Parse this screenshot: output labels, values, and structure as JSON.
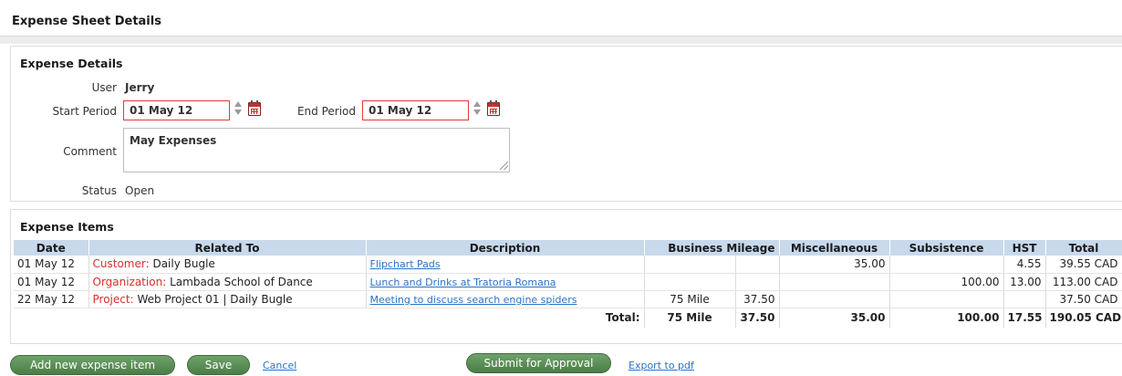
{
  "page": {
    "title": "Expense Sheet Details"
  },
  "details": {
    "section_title": "Expense Details",
    "user_label": "User",
    "user_value": "Jerry",
    "start_label": "Start Period",
    "start_value": "01 May 12",
    "end_label": "End Period",
    "end_value": "01 May 12",
    "comment_label": "Comment",
    "comment_value": "May Expenses",
    "status_label": "Status",
    "status_value": "Open"
  },
  "items": {
    "section_title": "Expense Items",
    "columns": [
      "Date",
      "Related To",
      "Description",
      "Business Mileage",
      "Miscellaneous",
      "Subsistence",
      "HST",
      "Total"
    ],
    "rows": [
      {
        "date": "01 May 12",
        "related_type": "Customer:",
        "related_name": "Daily Bugle",
        "description": "Flipchart Pads",
        "mileage": "",
        "mileage_amount": "",
        "misc": "35.00",
        "subsistence": "",
        "hst": "4.55",
        "total": "39.55 CAD"
      },
      {
        "date": "01 May 12",
        "related_type": "Organization:",
        "related_name": "Lambada School of Dance",
        "description": "Lunch and Drinks at Tratoria Romana",
        "mileage": "",
        "mileage_amount": "",
        "misc": "",
        "subsistence": "100.00",
        "hst": "13.00",
        "total": "113.00 CAD"
      },
      {
        "date": "22 May 12",
        "related_type": "Project:",
        "related_name": "Web Project 01 | Daily Bugle",
        "description": "Meeting to discuss search engine spiders",
        "mileage": "75 Mile",
        "mileage_amount": "37.50",
        "misc": "",
        "subsistence": "",
        "hst": "",
        "total": "37.50 CAD"
      }
    ],
    "totals": {
      "label": "Total:",
      "mileage": "75 Mile",
      "mileage_amount": "37.50",
      "misc": "35.00",
      "subsistence": "100.00",
      "hst": "17.55",
      "total": "190.05 CAD"
    }
  },
  "actions": {
    "add_item": "Add new expense item",
    "save": "Save",
    "cancel": "Cancel",
    "submit": "Submit for Approval",
    "export": "Export to pdf"
  },
  "colors": {
    "accent_green": "#4b7d47",
    "header_blue": "#c8d9ec",
    "required_red": "#e03a3a",
    "link_blue": "#2a73c6"
  }
}
